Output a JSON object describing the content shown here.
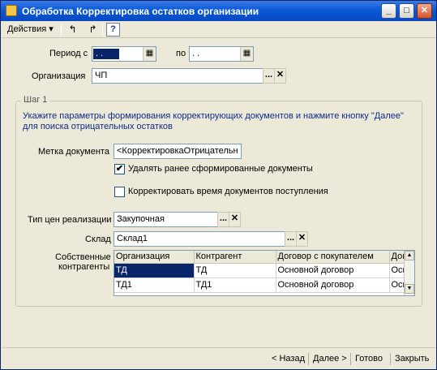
{
  "window": {
    "title": "Обработка  Корректировка остатков организации",
    "minimize_symbol": "_",
    "maximize_symbol": "□",
    "close_symbol": "✕"
  },
  "toolbar": {
    "actions_label": "Действия ▾",
    "undo_symbol": "↰",
    "redo_symbol": "↱",
    "help_symbol": "?"
  },
  "period": {
    "from_label": "Период с",
    "from_value": ". .",
    "to_label": "по",
    "to_value": ". ."
  },
  "organization": {
    "label": "Организация",
    "value": "ЧП"
  },
  "step": {
    "title": "Шаг 1",
    "hint": "Укажите параметры формирования корректирующих документов и нажмите кнопку \"Далее\" для поиска отрицательных остатков"
  },
  "document_mark": {
    "label": "Метка документа",
    "value": "<КорректировкаОтрицательн"
  },
  "options": {
    "delete_previous": {
      "label": "Удалять ранее сформированные документы",
      "checked": true,
      "mark": "✔"
    },
    "adjust_time": {
      "label": "Корректировать время документов поступления",
      "checked": false,
      "mark": ""
    }
  },
  "price_type": {
    "label": "Тип цен реализации",
    "value": "Закупочная"
  },
  "warehouse": {
    "label": "Склад",
    "value": "Склад1"
  },
  "counterparties": {
    "label_line1": "Собственные",
    "label_line2": "контрагенты",
    "columns": [
      "Организация",
      "Контрагент",
      "Договор с покупателем",
      "Дог"
    ],
    "rows": [
      [
        "ТД",
        "ТД",
        "Основной договор",
        "Осн"
      ],
      [
        "ТД1",
        "ТД1",
        "Основной договор",
        "Осн"
      ]
    ]
  },
  "icons": {
    "select": "...",
    "clear": "✕",
    "calendar": "▦",
    "scroll_up": "▲",
    "scroll_down": "▼"
  },
  "footer": {
    "back_label": "< Назад",
    "next_label": "Далее >",
    "done_label": "Готово",
    "close_label": "Закрыть"
  }
}
